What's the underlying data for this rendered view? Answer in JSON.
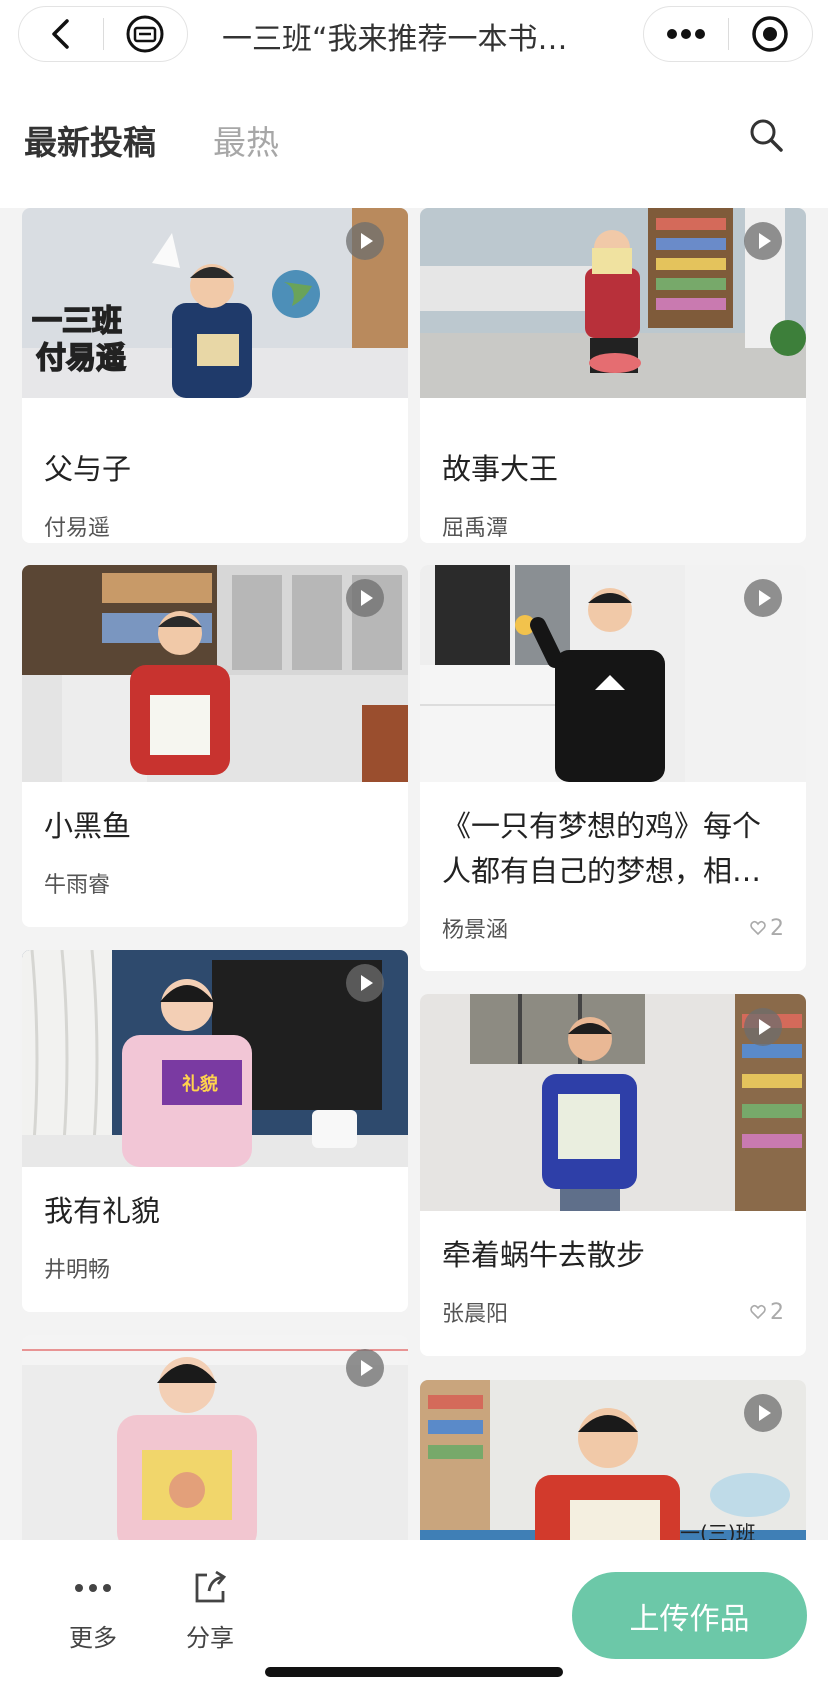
{
  "header": {
    "title": "一三班“我来推荐一本书…"
  },
  "tabs": [
    {
      "label": "最新投稿"
    },
    {
      "label": "最热"
    }
  ],
  "cards": [
    {
      "title": "父与子",
      "author": "付易遥",
      "overlay": "一三班\n付易遥"
    },
    {
      "title": "故事大王",
      "author": "屈禹潭"
    },
    {
      "title": "小黑鱼",
      "author": "牛雨睿"
    },
    {
      "title": "《一只有梦想的鸡》每个人都有自己的梦想，相…",
      "author": "杨景涵",
      "likes": "2"
    },
    {
      "title": "我有礼貌",
      "author": "井明畅"
    },
    {
      "title": "牵着蜗牛去散步",
      "author": "张晨阳",
      "likes": "2"
    },
    {
      "title": "",
      "author": ""
    },
    {
      "title": "",
      "author": ""
    }
  ],
  "bottom": {
    "more": "更多",
    "share": "分享",
    "upload": "上传作品"
  }
}
